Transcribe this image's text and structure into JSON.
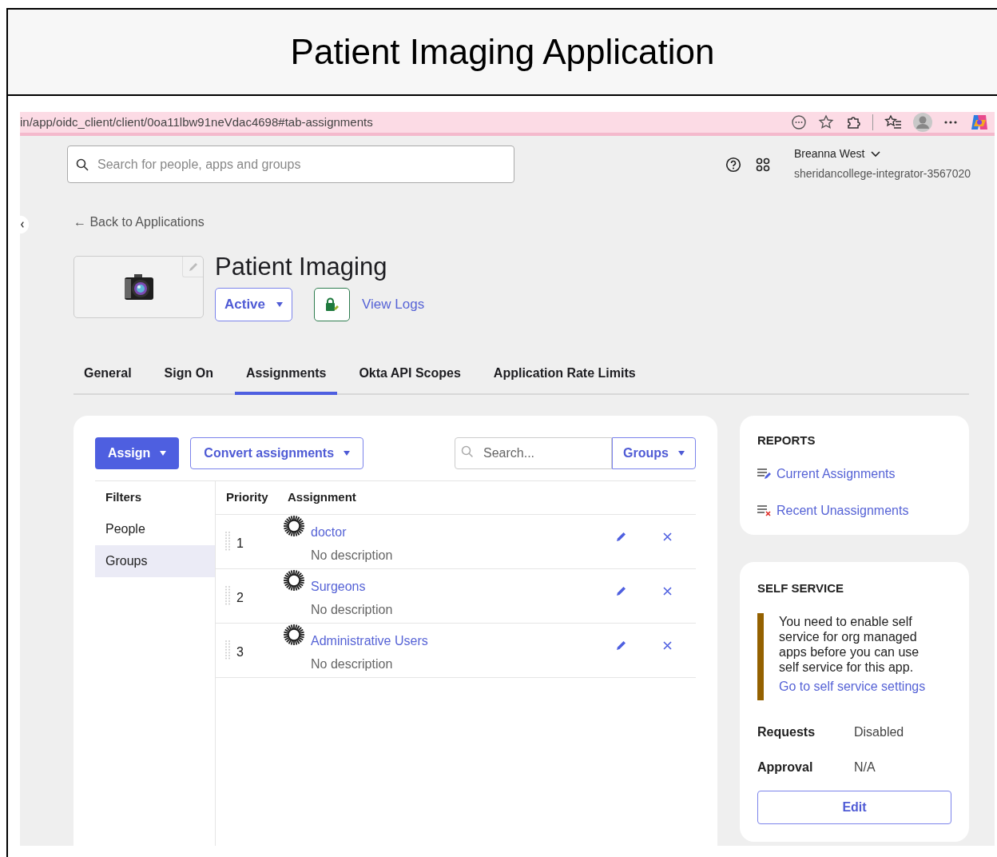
{
  "window": {
    "title": "Patient Imaging Application"
  },
  "browser": {
    "url": "in/app/oidc_client/client/0oa11lbw91neVdac4698#tab-assignments"
  },
  "header": {
    "search": {
      "placeholder": "Search for people, apps and groups"
    },
    "user": {
      "name": "Breanna West",
      "org": "sheridancollege-integrator-3567020"
    }
  },
  "back_link": "← Back to Applications",
  "app": {
    "name": "Patient Imaging",
    "status": "Active",
    "view_logs": "View Logs"
  },
  "tabs": [
    {
      "label": "General",
      "selected": false
    },
    {
      "label": "Sign On",
      "selected": false
    },
    {
      "label": "Assignments",
      "selected": true
    },
    {
      "label": "Okta API Scopes",
      "selected": false
    },
    {
      "label": "Application Rate Limits",
      "selected": false
    }
  ],
  "toolbar": {
    "assign": "Assign",
    "convert": "Convert assignments",
    "search": {
      "placeholder": "Search..."
    },
    "type": "Groups"
  },
  "filters": {
    "title": "Filters",
    "items": [
      {
        "label": "People",
        "selected": false
      },
      {
        "label": "Groups",
        "selected": true
      }
    ]
  },
  "table": {
    "columns": [
      "Priority",
      "Assignment"
    ],
    "rows": [
      {
        "priority": "1",
        "name": "doctor",
        "description": "No description"
      },
      {
        "priority": "2",
        "name": "Surgeons",
        "description": "No description"
      },
      {
        "priority": "3",
        "name": "Administrative Users",
        "description": "No description"
      }
    ]
  },
  "reports": {
    "title": "REPORTS",
    "links": [
      {
        "kind": "current",
        "label": "Current Assignments"
      },
      {
        "kind": "recent",
        "label": "Recent Unassignments"
      }
    ]
  },
  "self_service": {
    "title": "SELF SERVICE",
    "notice": "You need to enable self service for org managed apps before you can use self service for this app.",
    "notice_link": "Go to self service settings",
    "fields": [
      {
        "label": "Requests",
        "value": "Disabled"
      },
      {
        "label": "Approval",
        "value": "N/A"
      }
    ],
    "edit": "Edit"
  }
}
